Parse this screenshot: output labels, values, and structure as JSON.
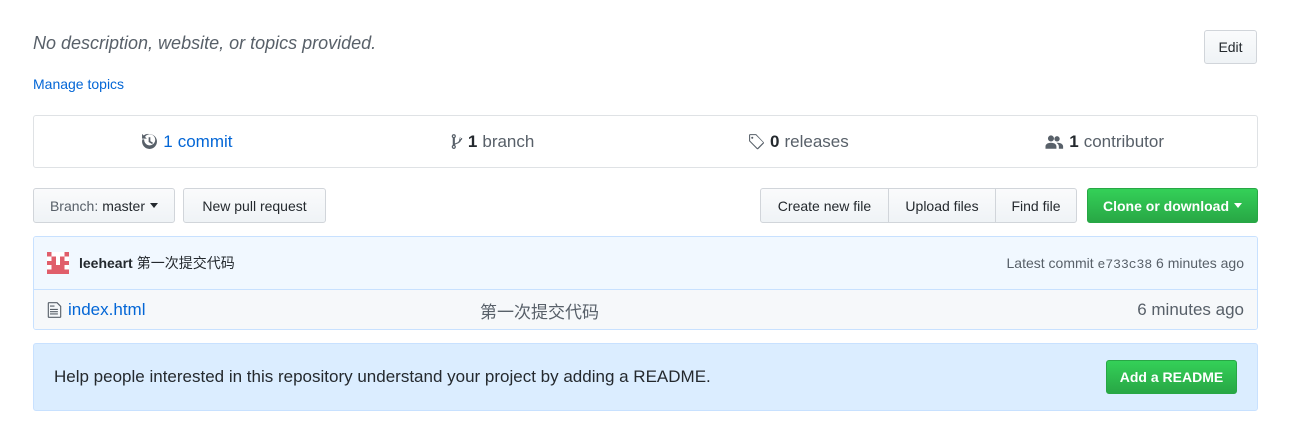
{
  "repo": {
    "description": "No description, website, or topics provided.",
    "edit_label": "Edit",
    "manage_topics": "Manage topics"
  },
  "stats": {
    "commits": {
      "num": "1",
      "label": "commit"
    },
    "branches": {
      "num": "1",
      "label": "branch"
    },
    "releases": {
      "num": "0",
      "label": "releases"
    },
    "contributors": {
      "num": "1",
      "label": "contributor"
    }
  },
  "toolbar": {
    "branch_prefix": "Branch:",
    "branch_name": "master",
    "new_pr": "New pull request",
    "create_file": "Create new file",
    "upload_files": "Upload files",
    "find_file": "Find file",
    "clone": "Clone or download"
  },
  "commit": {
    "author": "leeheart",
    "message": "第一次提交代码",
    "latest_label": "Latest commit",
    "sha": "e733c38",
    "age": "6 minutes ago"
  },
  "files": [
    {
      "name": "index.html",
      "message": "第一次提交代码",
      "age": "6 minutes ago"
    }
  ],
  "readme": {
    "text": "Help people interested in this repository understand your project by adding a README.",
    "button": "Add a README"
  },
  "colors": {
    "link": "#0366d6",
    "primary_green": "#28a745",
    "notice_bg": "#dbedff"
  }
}
